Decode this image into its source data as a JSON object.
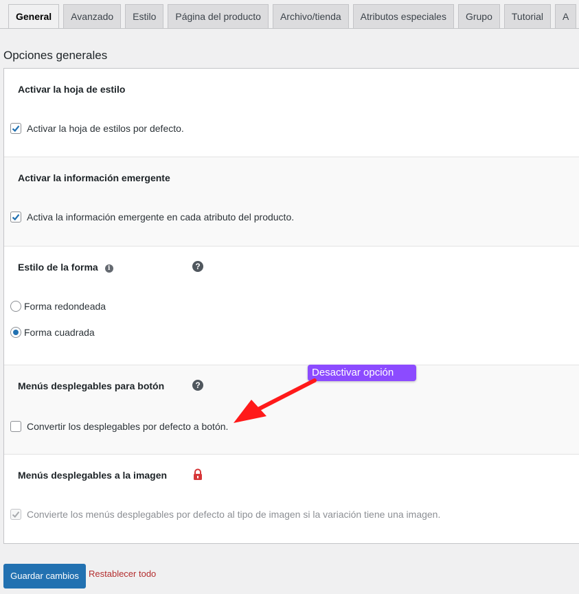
{
  "tabs": [
    {
      "label": "General"
    },
    {
      "label": "Avanzado"
    },
    {
      "label": "Estilo"
    },
    {
      "label": "Página del producto"
    },
    {
      "label": "Archivo/tienda"
    },
    {
      "label": "Atributos especiales"
    },
    {
      "label": "Grupo"
    },
    {
      "label": "Tutorial"
    },
    {
      "label": "A"
    }
  ],
  "section_title": "Opciones generales",
  "rows": {
    "stylesheet": {
      "title": "Activar la hoja de estilo",
      "option": "Activar la hoja de estilos por defecto.",
      "checked": true
    },
    "tooltip": {
      "title": "Activar la información emergente",
      "option": "Activa la información emergente en cada atributo del producto.",
      "checked": true
    },
    "shape": {
      "title": "Estilo de la forma",
      "options": [
        {
          "label": "Forma redondeada",
          "selected": false
        },
        {
          "label": "Forma cuadrada",
          "selected": true
        }
      ]
    },
    "dropdown_button": {
      "title": "Menús desplegables para botón",
      "option": "Convertir los desplegables por defecto a botón.",
      "checked": false
    },
    "dropdown_image": {
      "title": "Menús desplegables a la imagen",
      "option": "Convierte los menús desplegables por defecto al tipo de imagen si la variación tiene una imagen.",
      "checked": true,
      "disabled": true
    }
  },
  "annotation": "Desactivar opción",
  "footer": {
    "save_label": "Guardar cambios",
    "reset_label": "Restablecer todo"
  },
  "colors": {
    "accent": "#2271b1",
    "annotation": "#8c4bff",
    "arrow": "#ff1a1a",
    "lock": "#d63638",
    "reset": "#b32d2e"
  },
  "icons": {
    "help": "question-circle-icon",
    "info": "info-icon",
    "lock": "lock-icon",
    "check": "checkmark-icon"
  }
}
